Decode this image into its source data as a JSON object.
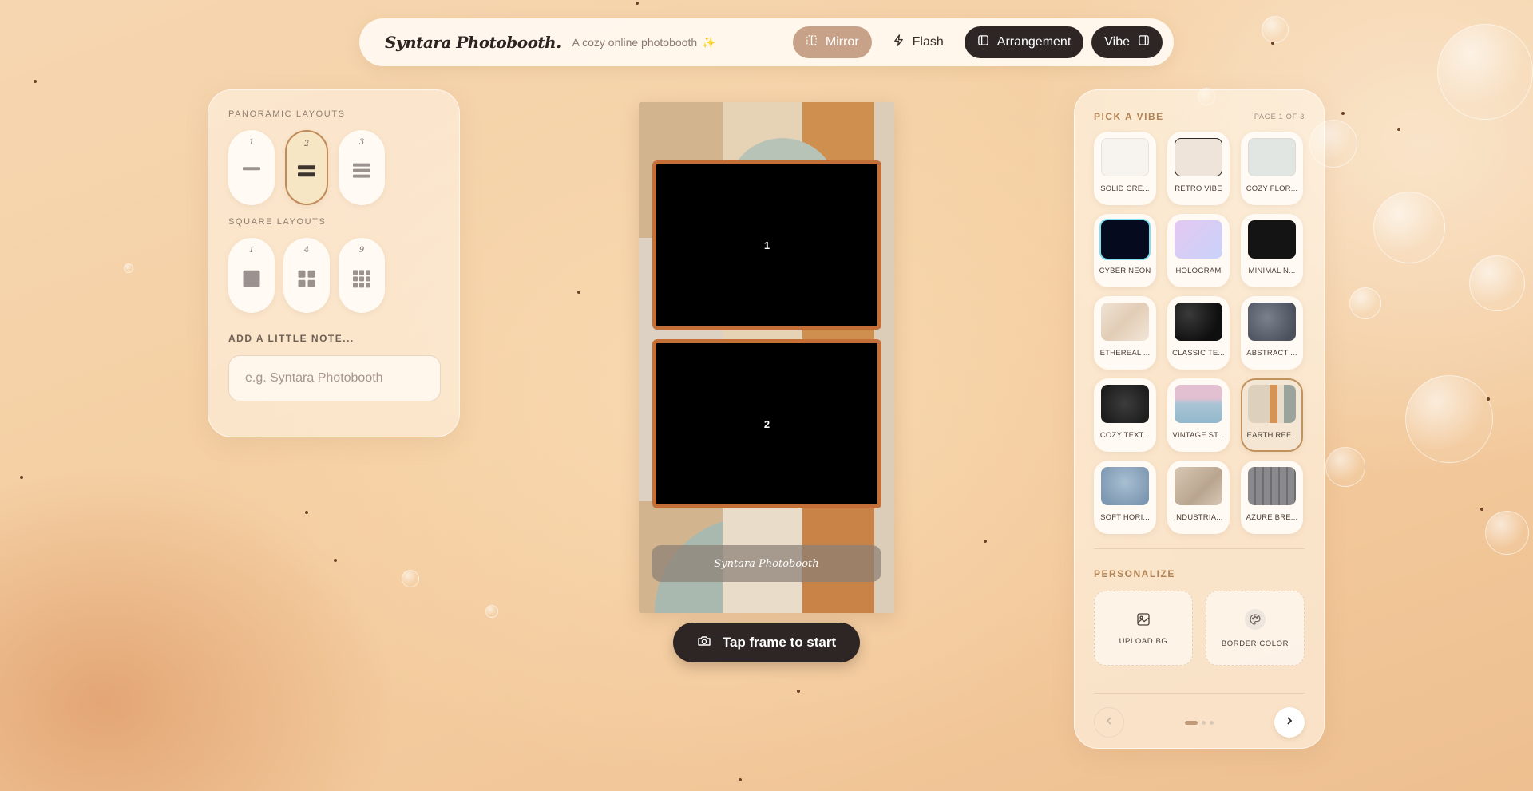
{
  "header": {
    "brand": "Syntara Photobooth.",
    "tagline": "A cozy online photobooth",
    "buttons": {
      "mirror": "Mirror",
      "flash": "Flash",
      "arrangement": "Arrangement",
      "vibe": "Vibe"
    }
  },
  "left_panel": {
    "panoramic_label": "PANORAMIC LAYOUTS",
    "panoramic_layouts": [
      "1",
      "2",
      "3"
    ],
    "panoramic_selected": "2",
    "square_label": "SQUARE LAYOUTS",
    "square_layouts": [
      "1",
      "4",
      "9"
    ],
    "note_label": "ADD A LITTLE NOTE...",
    "note_placeholder": "e.g. Syntara Photobooth",
    "note_value": ""
  },
  "strip": {
    "frames": [
      "1",
      "2"
    ],
    "caption": "Syntara Photobooth",
    "frame_border_color": "#c46f38"
  },
  "start_button": "Tap frame to start",
  "right_panel": {
    "title": "PICK A VIBE",
    "page": "PAGE 1 OF 3",
    "vibes": [
      {
        "label": "SOLID CRE...",
        "color": "#f7f3ee"
      },
      {
        "label": "RETRO VIBE",
        "color": "#efe4da"
      },
      {
        "label": "COZY FLOR...",
        "color": "#e2e6e2"
      },
      {
        "label": "CYBER NEON",
        "color": "#050a1f"
      },
      {
        "label": "HOLOGRAM",
        "color": "#d7c8f2"
      },
      {
        "label": "MINIMAL N...",
        "color": "#141414"
      },
      {
        "label": "ETHEREAL ...",
        "color": "#e8d6c6"
      },
      {
        "label": "CLASSIC TE...",
        "color": "#1a1a1a"
      },
      {
        "label": "ABSTRACT ...",
        "color": "#5c6370"
      },
      {
        "label": "COZY TEXT...",
        "color": "#2a2a2a"
      },
      {
        "label": "VINTAGE ST...",
        "color": "#b7c9d6"
      },
      {
        "label": "EARTH REF...",
        "color": "#d9c8ae"
      },
      {
        "label": "SOFT HORI...",
        "color": "#8fa8c0"
      },
      {
        "label": "INDUSTRIA...",
        "color": "#c8b8a4"
      },
      {
        "label": "AZURE BRE...",
        "color": "#7b7b7e"
      }
    ],
    "selected_vibe": "EARTH REF...",
    "personalize_label": "PERSONALIZE",
    "upload_label": "UPLOAD BG",
    "border_color_label": "BORDER COLOR",
    "pages": 3,
    "current_page": 1
  },
  "icons": {
    "mirror": "mirror-icon",
    "flash": "flash-icon",
    "arrangement": "sidebar-icon",
    "vibe": "sidebar-right-icon",
    "camera": "camera-icon",
    "upload": "image-icon",
    "palette": "palette-icon",
    "prev": "chevron-left-icon",
    "next": "chevron-right-icon"
  },
  "colors": {
    "accent": "#b08356",
    "dark": "#2d2624",
    "mirror_active": "#c7a288"
  }
}
